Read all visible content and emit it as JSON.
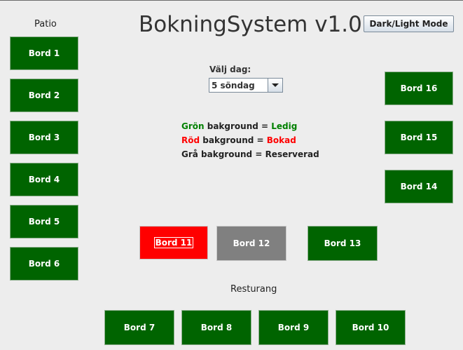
{
  "header": {
    "title": "BokningSystem v1.0",
    "mode_button": "Dark/Light Mode"
  },
  "sections": {
    "patio": "Patio",
    "restaurant": "Resturang"
  },
  "day_picker": {
    "label": "Välj dag:",
    "selected": "5 söndag"
  },
  "legend": [
    {
      "color_word": "Grön",
      "middle": " bakground = ",
      "status": "Ledig",
      "color": "#008000"
    },
    {
      "color_word": "Röd",
      "middle": " bakground = ",
      "status": "Bokad",
      "color": "#ff0000"
    },
    {
      "color_word": "Grå",
      "middle": " bakground = ",
      "status": "Reserverad",
      "color": "#222222"
    }
  ],
  "tables": {
    "bord1": "Bord 1",
    "bord2": "Bord 2",
    "bord3": "Bord 3",
    "bord4": "Bord 4",
    "bord5": "Bord 5",
    "bord6": "Bord 6",
    "bord7": "Bord 7",
    "bord8": "Bord 8",
    "bord9": "Bord 9",
    "bord10": "Bord 10",
    "bord11": "Bord 11",
    "bord12": "Bord 12",
    "bord13": "Bord 13",
    "bord14": "Bord 14",
    "bord15": "Bord 15",
    "bord16": "Bord 16"
  },
  "colors": {
    "free": "#006400",
    "booked": "#ff0000",
    "reserved": "#808080"
  }
}
